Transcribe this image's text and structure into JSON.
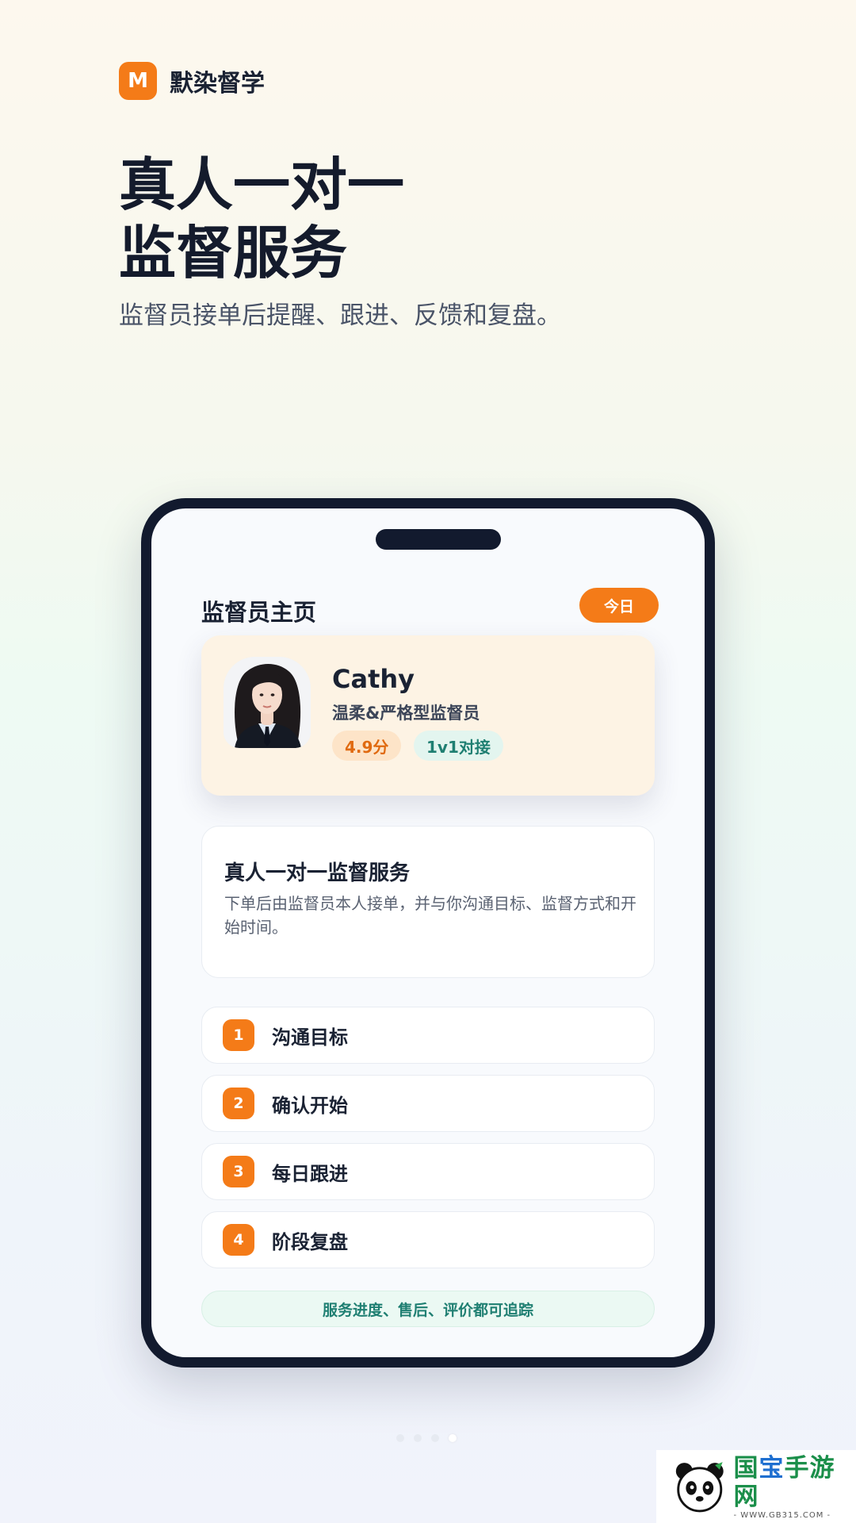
{
  "brand": {
    "logo_letter": "M",
    "name": "默染督学",
    "accent": "#f47b18"
  },
  "hero": {
    "title_line1": "真人一对一",
    "title_line2": "监督服务",
    "subtitle": "监督员接单后提醒、跟进、反馈和复盘。"
  },
  "phone": {
    "page_title": "监督员主页",
    "today_button": "今日",
    "profile": {
      "name": "Cathy",
      "role": "温柔&严格型监督员",
      "score": "4.9分",
      "mode": "1v1对接"
    },
    "service": {
      "title": "真人一对一监督服务",
      "description": "下单后由监督员本人接单，并与你沟通目标、监督方式和开始时间。"
    },
    "steps": [
      {
        "num": "1",
        "label": "沟通目标"
      },
      {
        "num": "2",
        "label": "确认开始"
      },
      {
        "num": "3",
        "label": "每日跟进"
      },
      {
        "num": "4",
        "label": "阶段复盘"
      }
    ],
    "footer_note": "服务进度、售后、评价都可追踪"
  },
  "pager": {
    "count": 4,
    "active_index": 3
  },
  "watermark": {
    "title_prefix": "国",
    "title_mid": "宝",
    "title_suffix": "手游网",
    "url": "- WWW.GB315.COM -"
  }
}
